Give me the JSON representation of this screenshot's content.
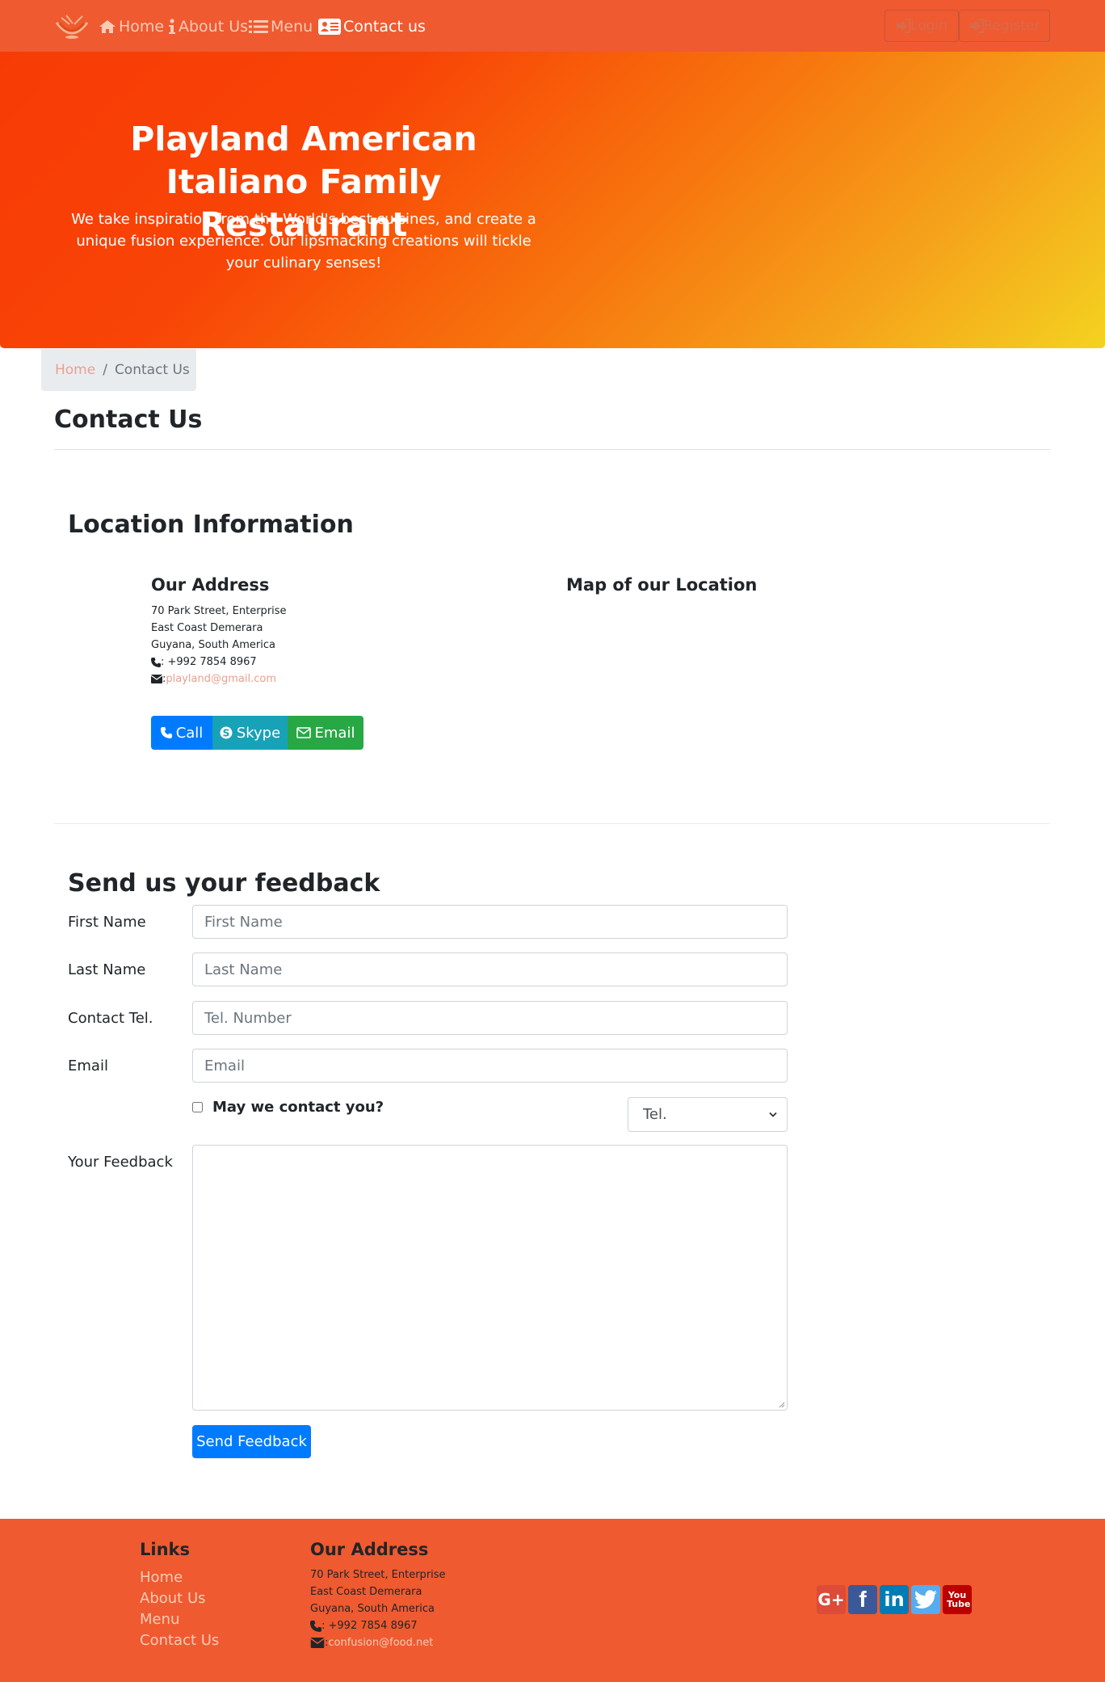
{
  "nav": {
    "items": [
      {
        "label": "Home",
        "icon": "home-icon"
      },
      {
        "label": "About Us",
        "icon": "info-icon"
      },
      {
        "label": "Menu",
        "icon": "list-icon"
      },
      {
        "label": "Contact us",
        "icon": "address-card-icon"
      }
    ],
    "login_label": "Login",
    "register_label": "Register"
  },
  "jumbotron": {
    "title": "Playland American Italiano Family Restaurant",
    "subtitle": "We take inspiration from the World's best cuisines, and create a unique fusion experience. Our lipsmacking creations will tickle your culinary senses!"
  },
  "breadcrumb": {
    "home": "Home",
    "separator": "/",
    "current": "Contact Us"
  },
  "page_title": "Contact Us",
  "location": {
    "heading": "Location Information",
    "address_heading": "Our Address",
    "map_heading": "Map of our Location",
    "address_lines": [
      "70 Park Street, Enterprise",
      "East Coast Demerara",
      "Guyana, South America"
    ],
    "phone": ": +992 7854 8967",
    "email_prefix": ": ",
    "email": "playland@gmail.com",
    "buttons": {
      "call": "Call",
      "skype": "Skype",
      "email": "Email"
    }
  },
  "feedback": {
    "heading": "Send us your feedback",
    "first_name_label": "First Name",
    "first_name_placeholder": "First Name",
    "last_name_label": "Last Name",
    "last_name_placeholder": "Last Name",
    "tel_label": "Contact Tel.",
    "tel_placeholder": "Tel. Number",
    "email_label": "Email",
    "email_placeholder": "Email",
    "contact_check_label": "May we contact you?",
    "contact_select_value": "Tel.",
    "message_label": "Your Feedback",
    "submit_label": "Send Feedback"
  },
  "footer": {
    "links_heading": "Links",
    "links": [
      "Home",
      "About Us",
      "Menu",
      "Contact Us"
    ],
    "address_heading": "Our Address",
    "address_lines": [
      "70 Park Street, Enterprise",
      "East Coast Demerara",
      "Guyana, South America"
    ],
    "phone": ": +992 7854 8967",
    "email_prefix": ": ",
    "email": "confusion@food.net",
    "social": [
      {
        "name": "google-plus",
        "label": "G+",
        "color": "#dd4b39"
      },
      {
        "name": "facebook",
        "label": "f",
        "color": "#3b5998"
      },
      {
        "name": "linkedin",
        "label": "in",
        "color": "#007bb5"
      },
      {
        "name": "twitter",
        "label": "",
        "color": "#55acee"
      },
      {
        "name": "youtube",
        "label": "You Tube",
        "color": "#bb0000"
      }
    ]
  },
  "colors": {
    "primary": "#ef5a30",
    "link_light": "#fbcbb6",
    "call_button": "#007bff",
    "skype_button": "#17a2b8",
    "email_button": "#28a745"
  }
}
